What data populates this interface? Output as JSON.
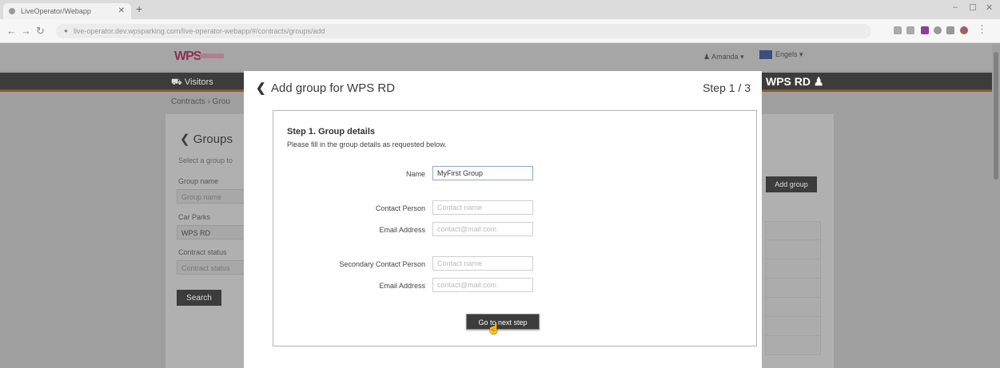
{
  "browser": {
    "tab_title": "LiveOperator/Webapp",
    "tab_close": "✕",
    "new_tab": "+",
    "url": "live-operator.dev.wpsparking.com/live-operator-webapp/#/contracts/groups/add",
    "win_min": "–",
    "win_max": "☐",
    "win_close": "✕"
  },
  "header": {
    "logo": "WPS",
    "user_menu": "Amanda ▾",
    "language": "Engels ▾"
  },
  "nav": {
    "visitors": "Visitors",
    "title": "WPS RD ♟"
  },
  "breadcrumb": "Contracts › Grou",
  "background_panel": {
    "back": "❮",
    "title": "Groups",
    "instruction": "Select a group to",
    "group_name_label": "Group name",
    "group_name_placeholder": "Group name",
    "car_park_label": "Car Parks",
    "car_park_value": "WPS RD",
    "contract_status_label": "Contract status",
    "contract_status_placeholder": "Contract status",
    "search_button": "Search",
    "add_group_button": "Add group"
  },
  "modal": {
    "back_icon": "❮",
    "title": "Add group for WPS RD",
    "step": "Step 1 / 3",
    "section_title": "Step 1. Group details",
    "section_subtitle": "Please fill in the group details as requested below.",
    "fields": {
      "name_label": "Name",
      "name_value": "MyFirst Group",
      "contact_person_label": "Contact Person",
      "contact_person_placeholder": "Contact name",
      "email_label": "Email Address",
      "email_placeholder": "contact@mail.com",
      "secondary_contact_label": "Secondary Contact Person",
      "secondary_contact_placeholder": "Contact name",
      "secondary_email_label": "Email Address",
      "secondary_email_placeholder": "contact@mail.com"
    },
    "next_button": "Go to next step"
  }
}
